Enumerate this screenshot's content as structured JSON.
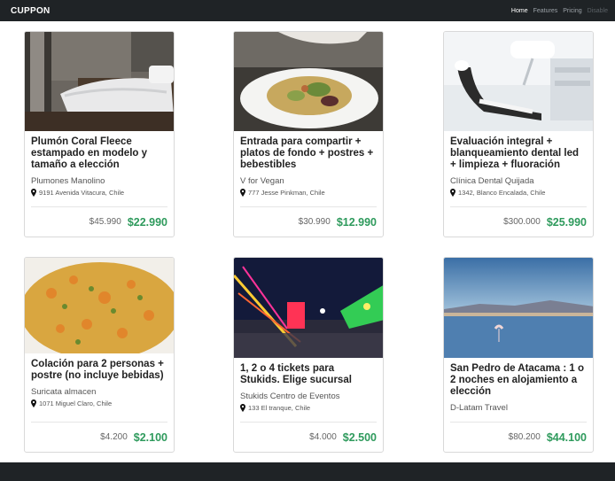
{
  "navbar": {
    "brand": "CUPPON",
    "links": [
      {
        "label": "Home",
        "state": "active"
      },
      {
        "label": "Features",
        "state": "normal"
      },
      {
        "label": "Pricing",
        "state": "normal"
      },
      {
        "label": "Disable",
        "state": "disabled"
      }
    ]
  },
  "deals": [
    {
      "title": "Plumón Coral Fleece estampado en modelo y tamaño a elección",
      "merchant": "Plumones Manolino",
      "address": "9191 Avenida Vitacura, Chile",
      "old_price": "$45.990",
      "new_price": "$22.990",
      "image_icon": "bedroom-photo"
    },
    {
      "title": "Entrada para compartir + platos de fondo + postres + bebestibles",
      "merchant": "V for Vegan",
      "address": "777 Jesse Pinkman, Chile",
      "old_price": "$30.990",
      "new_price": "$12.990",
      "image_icon": "salad-photo"
    },
    {
      "title": "Evaluación integral + blanqueamiento dental led + limpieza + fluoración",
      "merchant": "Clínica Dental Quijada",
      "address": "1342, Blanco Encalada, Chile",
      "old_price": "$300.000",
      "new_price": "$25.990",
      "image_icon": "dental-chair-photo"
    },
    {
      "title": "Colación para 2 personas + postre (no incluye bebidas)",
      "merchant": "Suricata almacen",
      "address": "1071 Miguel Claro, Chile",
      "old_price": "$4.200",
      "new_price": "$2.100",
      "image_icon": "curry-dish-photo"
    },
    {
      "title": "1, 2 o 4 tickets para Stukids. Elige sucursal",
      "merchant": "Stukids Centro de Eventos",
      "address": "133 El tranque, Chile",
      "old_price": "$4.000",
      "new_price": "$2.500",
      "image_icon": "fairground-photo"
    },
    {
      "title": "San Pedro de Atacama : 1 o 2 noches en alojamiento a elección",
      "merchant": "D-Latam Travel",
      "address": "",
      "old_price": "$80.200",
      "new_price": "$44.100",
      "image_icon": "flamingo-lake-photo"
    }
  ],
  "colors": {
    "navbar_bg": "#1f2326",
    "price_green": "#2e9a5c"
  }
}
